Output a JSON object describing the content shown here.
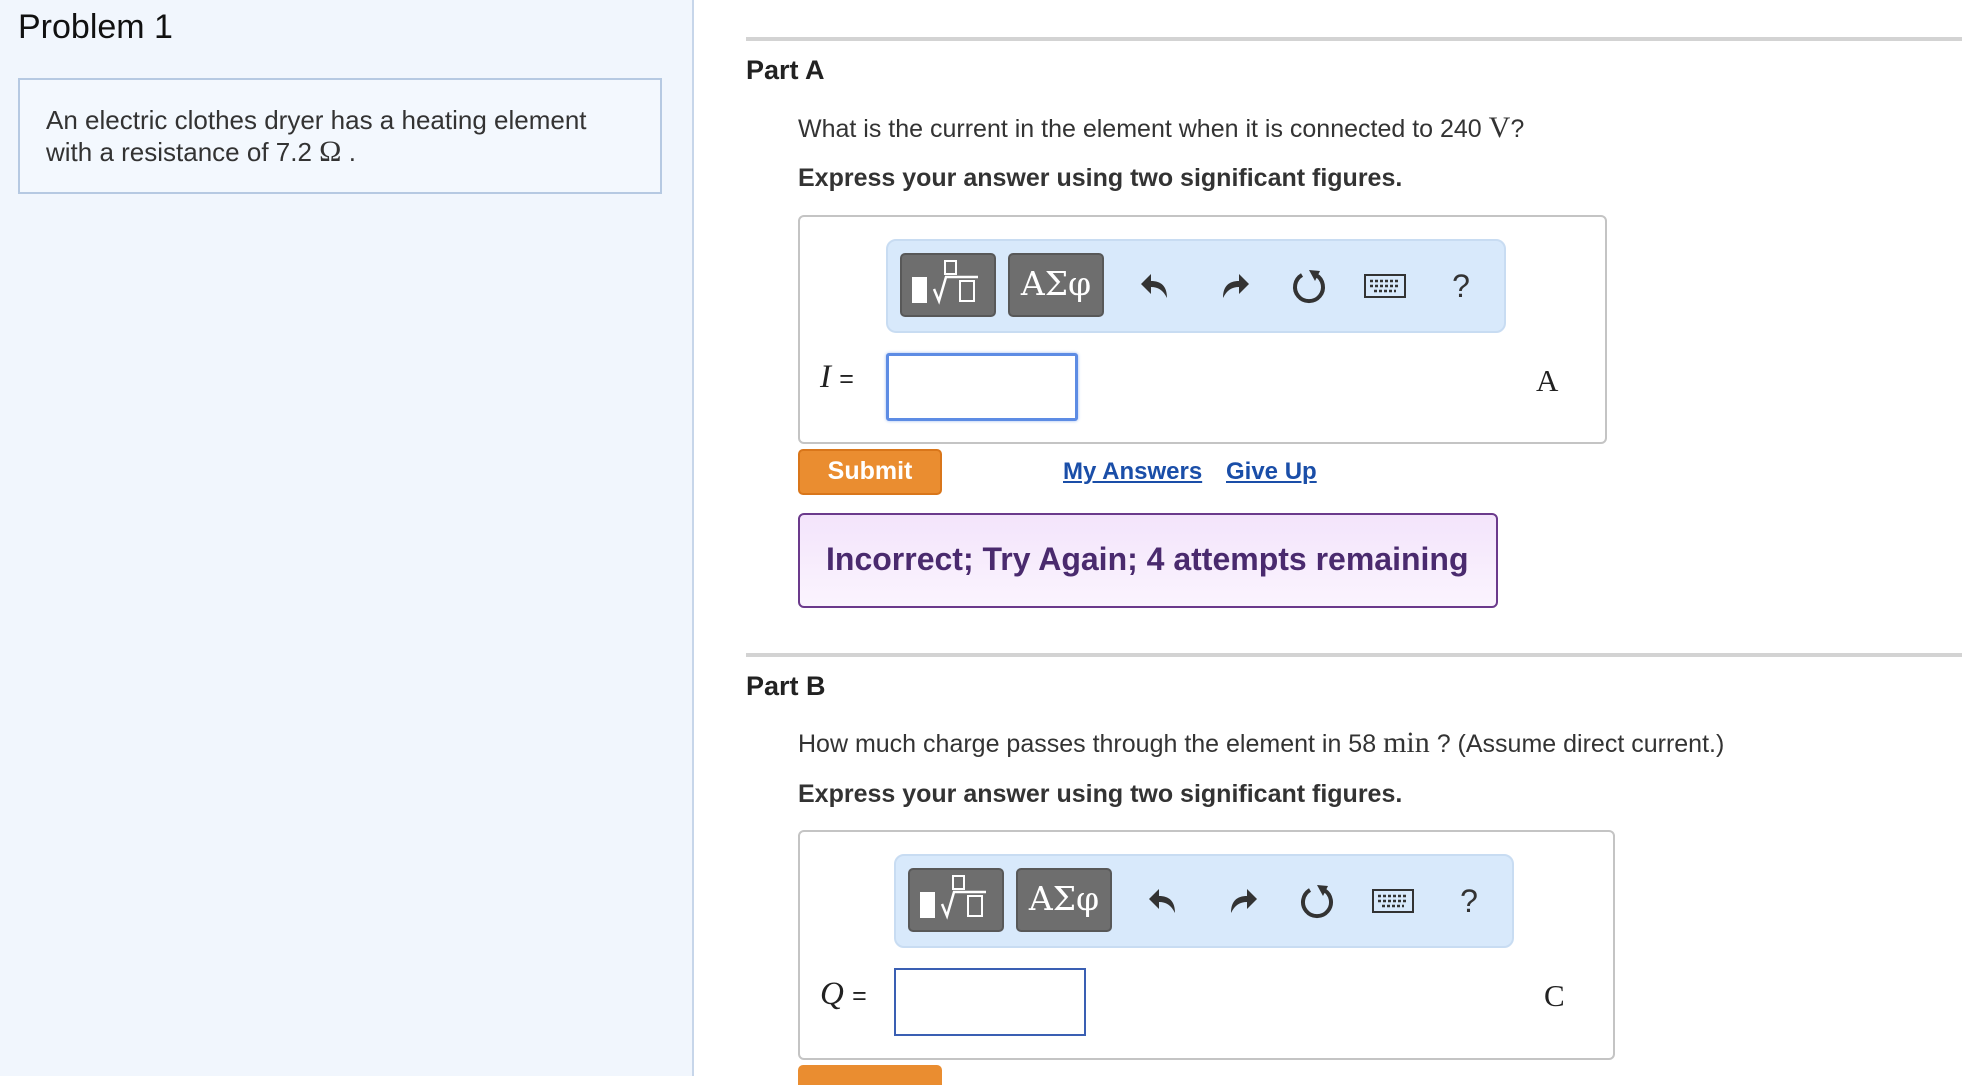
{
  "problem": {
    "title": "Problem 1",
    "text": "An electric clothes dryer has a heating element with a resistance of 7.2",
    "unit_symbol": "Ω",
    "end_punct": "."
  },
  "toolbar": {
    "greek_label": "ΑΣφ",
    "help_label": "?"
  },
  "part_a": {
    "title": "Part A",
    "question_prefix": "What is the current in the element when it is connected to 240",
    "question_unit": "V",
    "question_suffix": "?",
    "instruction": "Express your answer using two significant figures.",
    "variable": "I",
    "equals": "=",
    "answer_value": "",
    "unit": "A",
    "submit_label": "Submit",
    "my_answers_label": "My Answers",
    "give_up_label": "Give Up",
    "feedback": "Incorrect; Try Again; 4 attempts remaining"
  },
  "part_b": {
    "title": "Part B",
    "question_prefix": "How much charge passes through the element in 58",
    "question_unit": "min",
    "question_suffix": "? (Assume direct current.)",
    "instruction": "Express your answer using two significant figures.",
    "variable": "Q",
    "equals": "=",
    "answer_value": "",
    "unit": "C"
  },
  "colors": {
    "submit": "#ea8d30",
    "link": "#1a4ea8",
    "feedback_border": "#6b3a8c",
    "toolbar_bg": "#d8e9fb"
  }
}
